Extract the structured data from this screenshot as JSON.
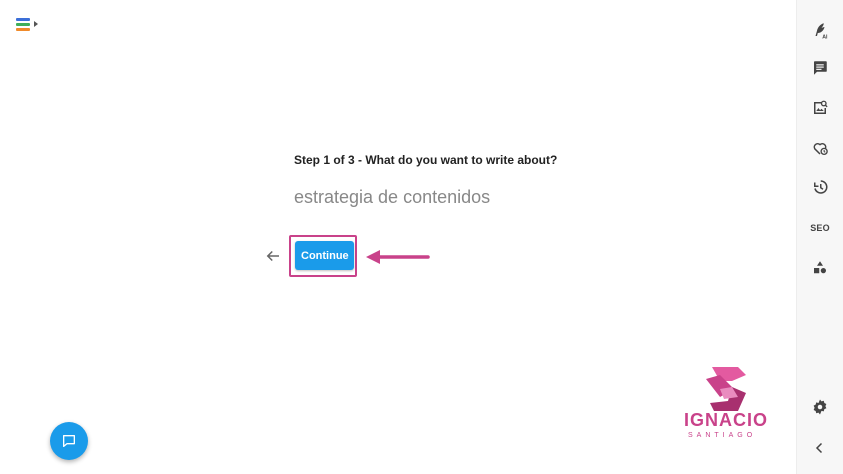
{
  "wizard": {
    "step_label": "Step 1 of 3 - What do you want to write about?",
    "topic_value": "estrategia de contenidos",
    "continue_label": "Continue"
  },
  "rail": {
    "seo_label": "SEO",
    "ai_label": "AI"
  },
  "logo": {
    "name": "IGNACIO",
    "sub": "SANTIAGO"
  },
  "colors": {
    "primary": "#1a9bea",
    "highlight": "#c9428a",
    "menu_bar_1": "#3c6fd8",
    "menu_bar_2": "#3fae5a",
    "menu_bar_3": "#f08a2a"
  },
  "icons": [
    "app-menu-icon",
    "ai-feather-icon",
    "comment-icon",
    "image-search-icon",
    "heart-clock-icon",
    "history-icon",
    "seo-icon",
    "shapes-icon",
    "settings-icon",
    "collapse-chevron-icon",
    "back-arrow-icon",
    "chat-icon"
  ]
}
